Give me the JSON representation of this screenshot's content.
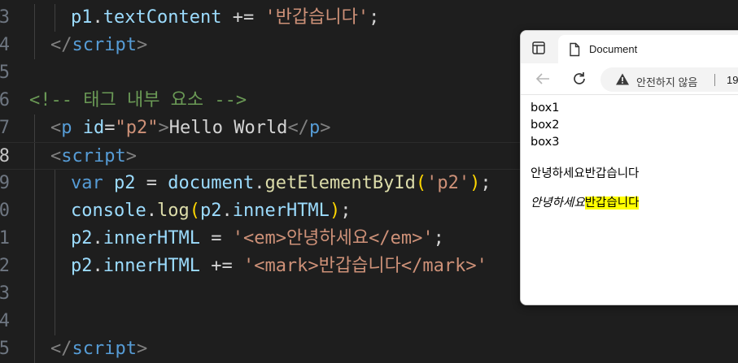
{
  "editor": {
    "lines": [
      {
        "num": "3",
        "tokens": [
          {
            "c": "t-id",
            "t": "p1"
          },
          {
            "c": "t-op",
            "t": "."
          },
          {
            "c": "t-id",
            "t": "textContent"
          },
          {
            "c": "t-op",
            "t": " += "
          },
          {
            "c": "t-str",
            "t": "'반갑습니다'"
          },
          {
            "c": "t-op",
            "t": ";"
          }
        ]
      },
      {
        "num": "4",
        "tokens": [
          {
            "c": "t-punc",
            "t": "</"
          },
          {
            "c": "t-tag",
            "t": "script"
          },
          {
            "c": "t-punc",
            "t": ">"
          }
        ]
      },
      {
        "num": "5",
        "tokens": []
      },
      {
        "num": "6",
        "tokens": [
          {
            "c": "t-cmt",
            "t": "<!-- 태그 내부 요소 -->"
          }
        ]
      },
      {
        "num": "7",
        "tokens": [
          {
            "c": "t-punc",
            "t": "<"
          },
          {
            "c": "t-tag",
            "t": "p"
          },
          {
            "c": "t-attr",
            "t": " id"
          },
          {
            "c": "t-op",
            "t": "="
          },
          {
            "c": "t-str",
            "t": "\"p2\""
          },
          {
            "c": "t-punc",
            "t": ">"
          },
          {
            "c": "t-txt",
            "t": "Hello World"
          },
          {
            "c": "t-punc",
            "t": "</"
          },
          {
            "c": "t-tag",
            "t": "p"
          },
          {
            "c": "t-punc",
            "t": ">"
          }
        ]
      },
      {
        "num": "8",
        "tokens": [
          {
            "c": "t-punc",
            "t": "<"
          },
          {
            "c": "t-tag",
            "t": "script"
          },
          {
            "c": "t-punc",
            "t": ">"
          }
        ]
      },
      {
        "num": "9",
        "tokens": [
          {
            "c": "t-var",
            "t": "var"
          },
          {
            "c": "t-id",
            "t": " p2"
          },
          {
            "c": "t-op",
            "t": " = "
          },
          {
            "c": "t-id",
            "t": "document"
          },
          {
            "c": "t-op",
            "t": "."
          },
          {
            "c": "t-fn",
            "t": "getElementById"
          },
          {
            "c": "t-brk",
            "t": "("
          },
          {
            "c": "t-str",
            "t": "'p2'"
          },
          {
            "c": "t-brk",
            "t": ")"
          },
          {
            "c": "t-op",
            "t": ";"
          }
        ]
      },
      {
        "num": "0",
        "tokens": [
          {
            "c": "t-id",
            "t": "console"
          },
          {
            "c": "t-op",
            "t": "."
          },
          {
            "c": "t-fn",
            "t": "log"
          },
          {
            "c": "t-brk",
            "t": "("
          },
          {
            "c": "t-id",
            "t": "p2"
          },
          {
            "c": "t-op",
            "t": "."
          },
          {
            "c": "t-id",
            "t": "innerHTML"
          },
          {
            "c": "t-brk",
            "t": ")"
          },
          {
            "c": "t-op",
            "t": ";"
          }
        ]
      },
      {
        "num": "1",
        "tokens": [
          {
            "c": "t-id",
            "t": "p2"
          },
          {
            "c": "t-op",
            "t": "."
          },
          {
            "c": "t-id",
            "t": "innerHTML"
          },
          {
            "c": "t-op",
            "t": " = "
          },
          {
            "c": "t-str",
            "t": "'<em>안녕하세요</em>'"
          },
          {
            "c": "t-op",
            "t": ";"
          }
        ]
      },
      {
        "num": "2",
        "tokens": [
          {
            "c": "t-id",
            "t": "p2"
          },
          {
            "c": "t-op",
            "t": "."
          },
          {
            "c": "t-id",
            "t": "innerHTML"
          },
          {
            "c": "t-op",
            "t": " += "
          },
          {
            "c": "t-str",
            "t": "'<mark>반갑습니다</mark>'"
          }
        ]
      },
      {
        "num": "3",
        "tokens": []
      },
      {
        "num": "4",
        "tokens": []
      },
      {
        "num": "5",
        "tokens": [
          {
            "c": "t-punc",
            "t": "</"
          },
          {
            "c": "t-tag",
            "t": "script"
          },
          {
            "c": "t-punc",
            "t": ">"
          }
        ]
      }
    ]
  },
  "browser": {
    "tab_title": "Document",
    "security_text": "안전하지 않음",
    "url_text": "19",
    "content": {
      "boxes": [
        "box1",
        "box2",
        "box3"
      ],
      "p1": "안녕하세요반갑습니다",
      "p2_em": "안녕하세요",
      "p2_mark": "반갑습니다"
    }
  },
  "colors": {
    "editor_bg": "#1e1e1e",
    "mark_highlight": "#ffff00",
    "string": "#ce9178",
    "keyword": "#569cd6",
    "comment": "#6a9955"
  },
  "icons": [
    "tab-actions-icon",
    "page-icon",
    "back-arrow-icon",
    "refresh-icon",
    "warning-icon"
  ]
}
